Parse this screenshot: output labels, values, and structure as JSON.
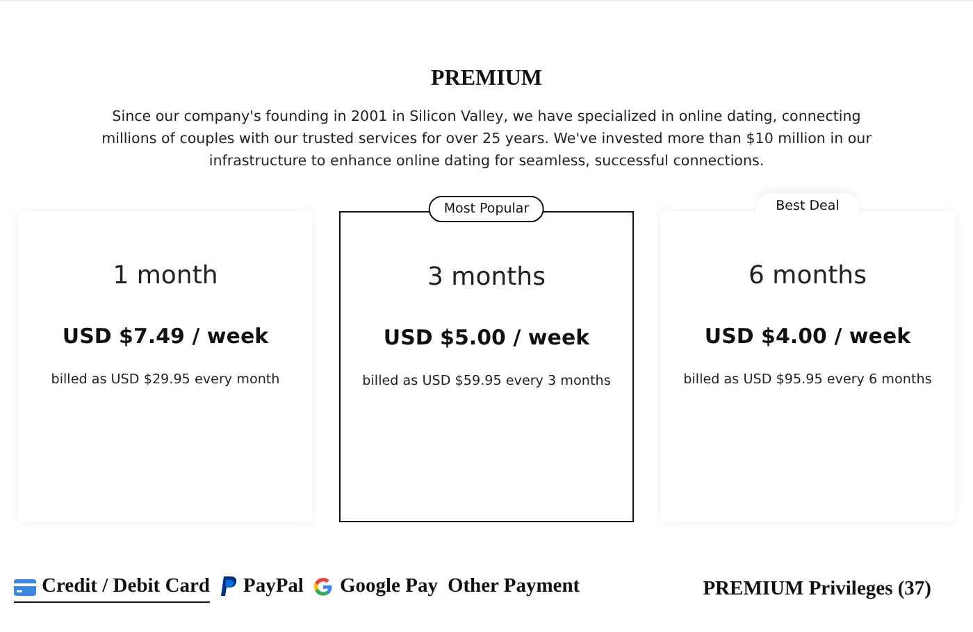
{
  "title": "PREMIUM",
  "intro": "Since our company's founding in 2001 in Silicon Valley, we have specialized in online dating, connecting millions of couples with our trusted services for over 25 years. We've invested more than $10 million in our infrastructure to enhance online dating for seamless, successful connections.",
  "plans": [
    {
      "duration": "1 month",
      "price": "USD $7.49 / week",
      "billing": "billed as USD $29.95 every month",
      "selected": false
    },
    {
      "duration": "3 months",
      "price": "USD $5.00 / week",
      "billing": "billed as USD $59.95 every 3 months",
      "selected": true,
      "badge": {
        "kind": "outlined",
        "label": "Most Popular"
      }
    },
    {
      "duration": "6 months",
      "price": "USD $4.00 / week",
      "billing": "billed as USD $95.95 every 6 months",
      "selected": false,
      "badge": {
        "kind": "tab",
        "label": "Best Deal"
      }
    }
  ],
  "payment_methods": [
    {
      "kind": "card",
      "label": "Credit / Debit Card",
      "selected": true
    },
    {
      "kind": "paypal",
      "label": "PayPal",
      "selected": false
    },
    {
      "kind": "google",
      "label": "Google Pay",
      "selected": false
    },
    {
      "kind": "other",
      "label": "Other Payment",
      "selected": false
    }
  ],
  "privileges_link": "PREMIUM Privileges (37)"
}
